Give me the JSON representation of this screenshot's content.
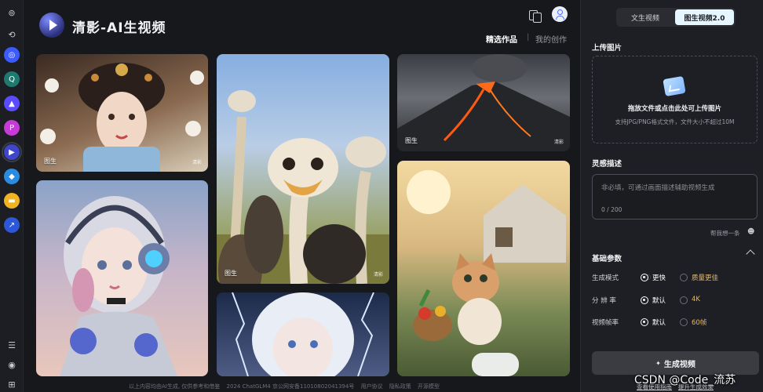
{
  "rail": {
    "icons": [
      "app-logo-icon",
      "history-icon",
      "chatglm-icon",
      "search-app-icon",
      "ai-app-icon",
      "ppt-app-icon",
      "qingying-app-icon",
      "agent-app-icon",
      "folder-icon",
      "chart-app-icon"
    ],
    "bottom_icons": [
      "list-icon",
      "target-icon",
      "grid-icon"
    ]
  },
  "header": {
    "brand": "清影-AI生视频",
    "tab_featured": "精选作品",
    "tab_sep": "|",
    "tab_mine": "我的创作"
  },
  "gallery": {
    "label": "图生",
    "watermark": "清影"
  },
  "panel": {
    "mode_t2v": "文生视频",
    "mode_i2v": "图生视频2.0",
    "upload_title": "上传图片",
    "upload_main": "拖放文件或点击此处可上传图片",
    "upload_sub": "支持JPG/PNG格式文件，文件大小不超过10M",
    "prompt_title": "灵感描述",
    "prompt_placeholder": "非必填，可通过画面描述辅助视频生成",
    "prompt_count": "0 / 200",
    "help_link": "帮我想一条",
    "params_title": "基础参数",
    "mode_label": "生成模式",
    "mode_fast": "更快",
    "mode_quality": "质量更佳",
    "resolution_label": "分 辨 率",
    "res_default": "默认",
    "res_4k": "4K",
    "fps_label": "视频帧率",
    "fps_default": "默认",
    "fps_60": "60帧",
    "gen_button": "生成视频",
    "guide_link": "查看使用指南",
    "upgrade_link": "提升生成效果"
  },
  "footer": {
    "disclaimer": "以上内容均由AI生成, 仅供参考和借鉴",
    "copyright": "2024 ChatGLM4 京公网安备11010802041394号",
    "agreement": "用户协议",
    "privacy": "隐私政策",
    "opensource": "开源模型"
  },
  "overlay": {
    "csdn": "CSDN @Code_流苏"
  },
  "colors": {
    "background": "#16181c",
    "panel": "#1d1f24",
    "accent": "#e6f6ff",
    "option_off": "#e7b96a"
  }
}
